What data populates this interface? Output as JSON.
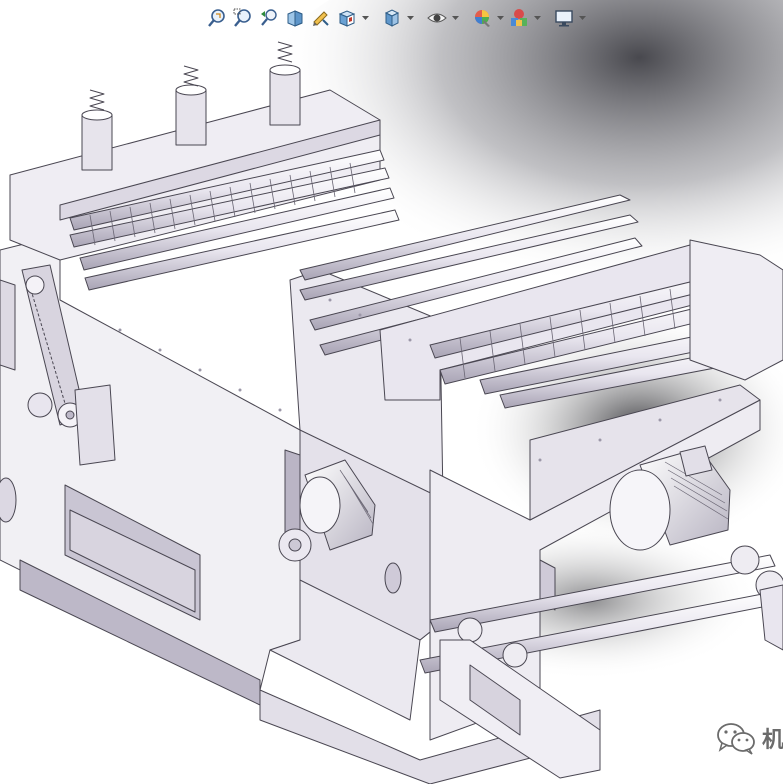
{
  "toolbar": {
    "buttons": [
      {
        "icon": "zoom-to-fit-icon"
      },
      {
        "icon": "zoom-to-area-icon"
      },
      {
        "icon": "previous-view-icon"
      },
      {
        "icon": "section-view-icon"
      },
      {
        "icon": "dynamic-annotation-icon"
      },
      {
        "icon": "view-orientation-icon",
        "dropdown": true
      },
      {
        "icon": "display-style-icon",
        "dropdown": true
      },
      {
        "icon": "hide-show-items-icon",
        "dropdown": true
      },
      {
        "icon": "edit-appearance-icon",
        "dropdown": true
      },
      {
        "icon": "apply-scene-icon",
        "dropdown": true
      },
      {
        "icon": "view-settings-icon",
        "dropdown": true
      }
    ]
  },
  "watermark": {
    "icon": "wechat-icon",
    "text": "机"
  },
  "colors": {
    "background": "#ffffff",
    "machine_fill": "#f1f0f4",
    "machine_edge": "#4a4752",
    "machine_shadow": "#c9c5d3",
    "shadow": "#5c5c62"
  }
}
